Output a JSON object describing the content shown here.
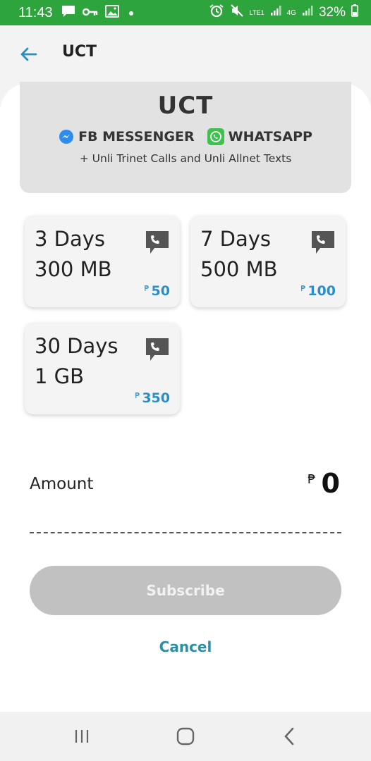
{
  "status_bar": {
    "time": "11:43",
    "battery": "32%",
    "network_lte": "LTE1",
    "network_4g": "4G",
    "icons": [
      "message-icon",
      "key-icon",
      "image-icon",
      "dot-icon",
      "alarm-icon",
      "mute-icon",
      "signal-icon",
      "battery-icon"
    ],
    "color": "#2ea43d"
  },
  "header": {
    "title": "UCT",
    "back_icon": "arrow-left-icon",
    "accent": "#2b8fc6"
  },
  "banner": {
    "title": "UCT",
    "apps": [
      {
        "label": "FB MESSENGER",
        "icon": "messenger-icon"
      },
      {
        "label": "WHATSAPP",
        "icon": "whatsapp-icon"
      }
    ],
    "subtitle": "+ Unli Trinet Calls and Unli Allnet Texts"
  },
  "plans": [
    {
      "days": "3 Days",
      "data": "300 MB",
      "currency": "₱",
      "price": "50",
      "icon": "call-bubble-icon"
    },
    {
      "days": "7 Days",
      "data": "500 MB",
      "currency": "₱",
      "price": "100",
      "icon": "call-bubble-icon"
    },
    {
      "days": "30 Days",
      "data": "1 GB",
      "currency": "₱",
      "price": "350",
      "icon": "call-bubble-icon"
    }
  ],
  "amount": {
    "label": "Amount",
    "currency": "₱",
    "value": "0"
  },
  "actions": {
    "subscribe": "Subscribe",
    "cancel": "Cancel"
  },
  "nav_bar": {
    "icons": [
      "recents-icon",
      "home-icon",
      "back-icon"
    ]
  }
}
